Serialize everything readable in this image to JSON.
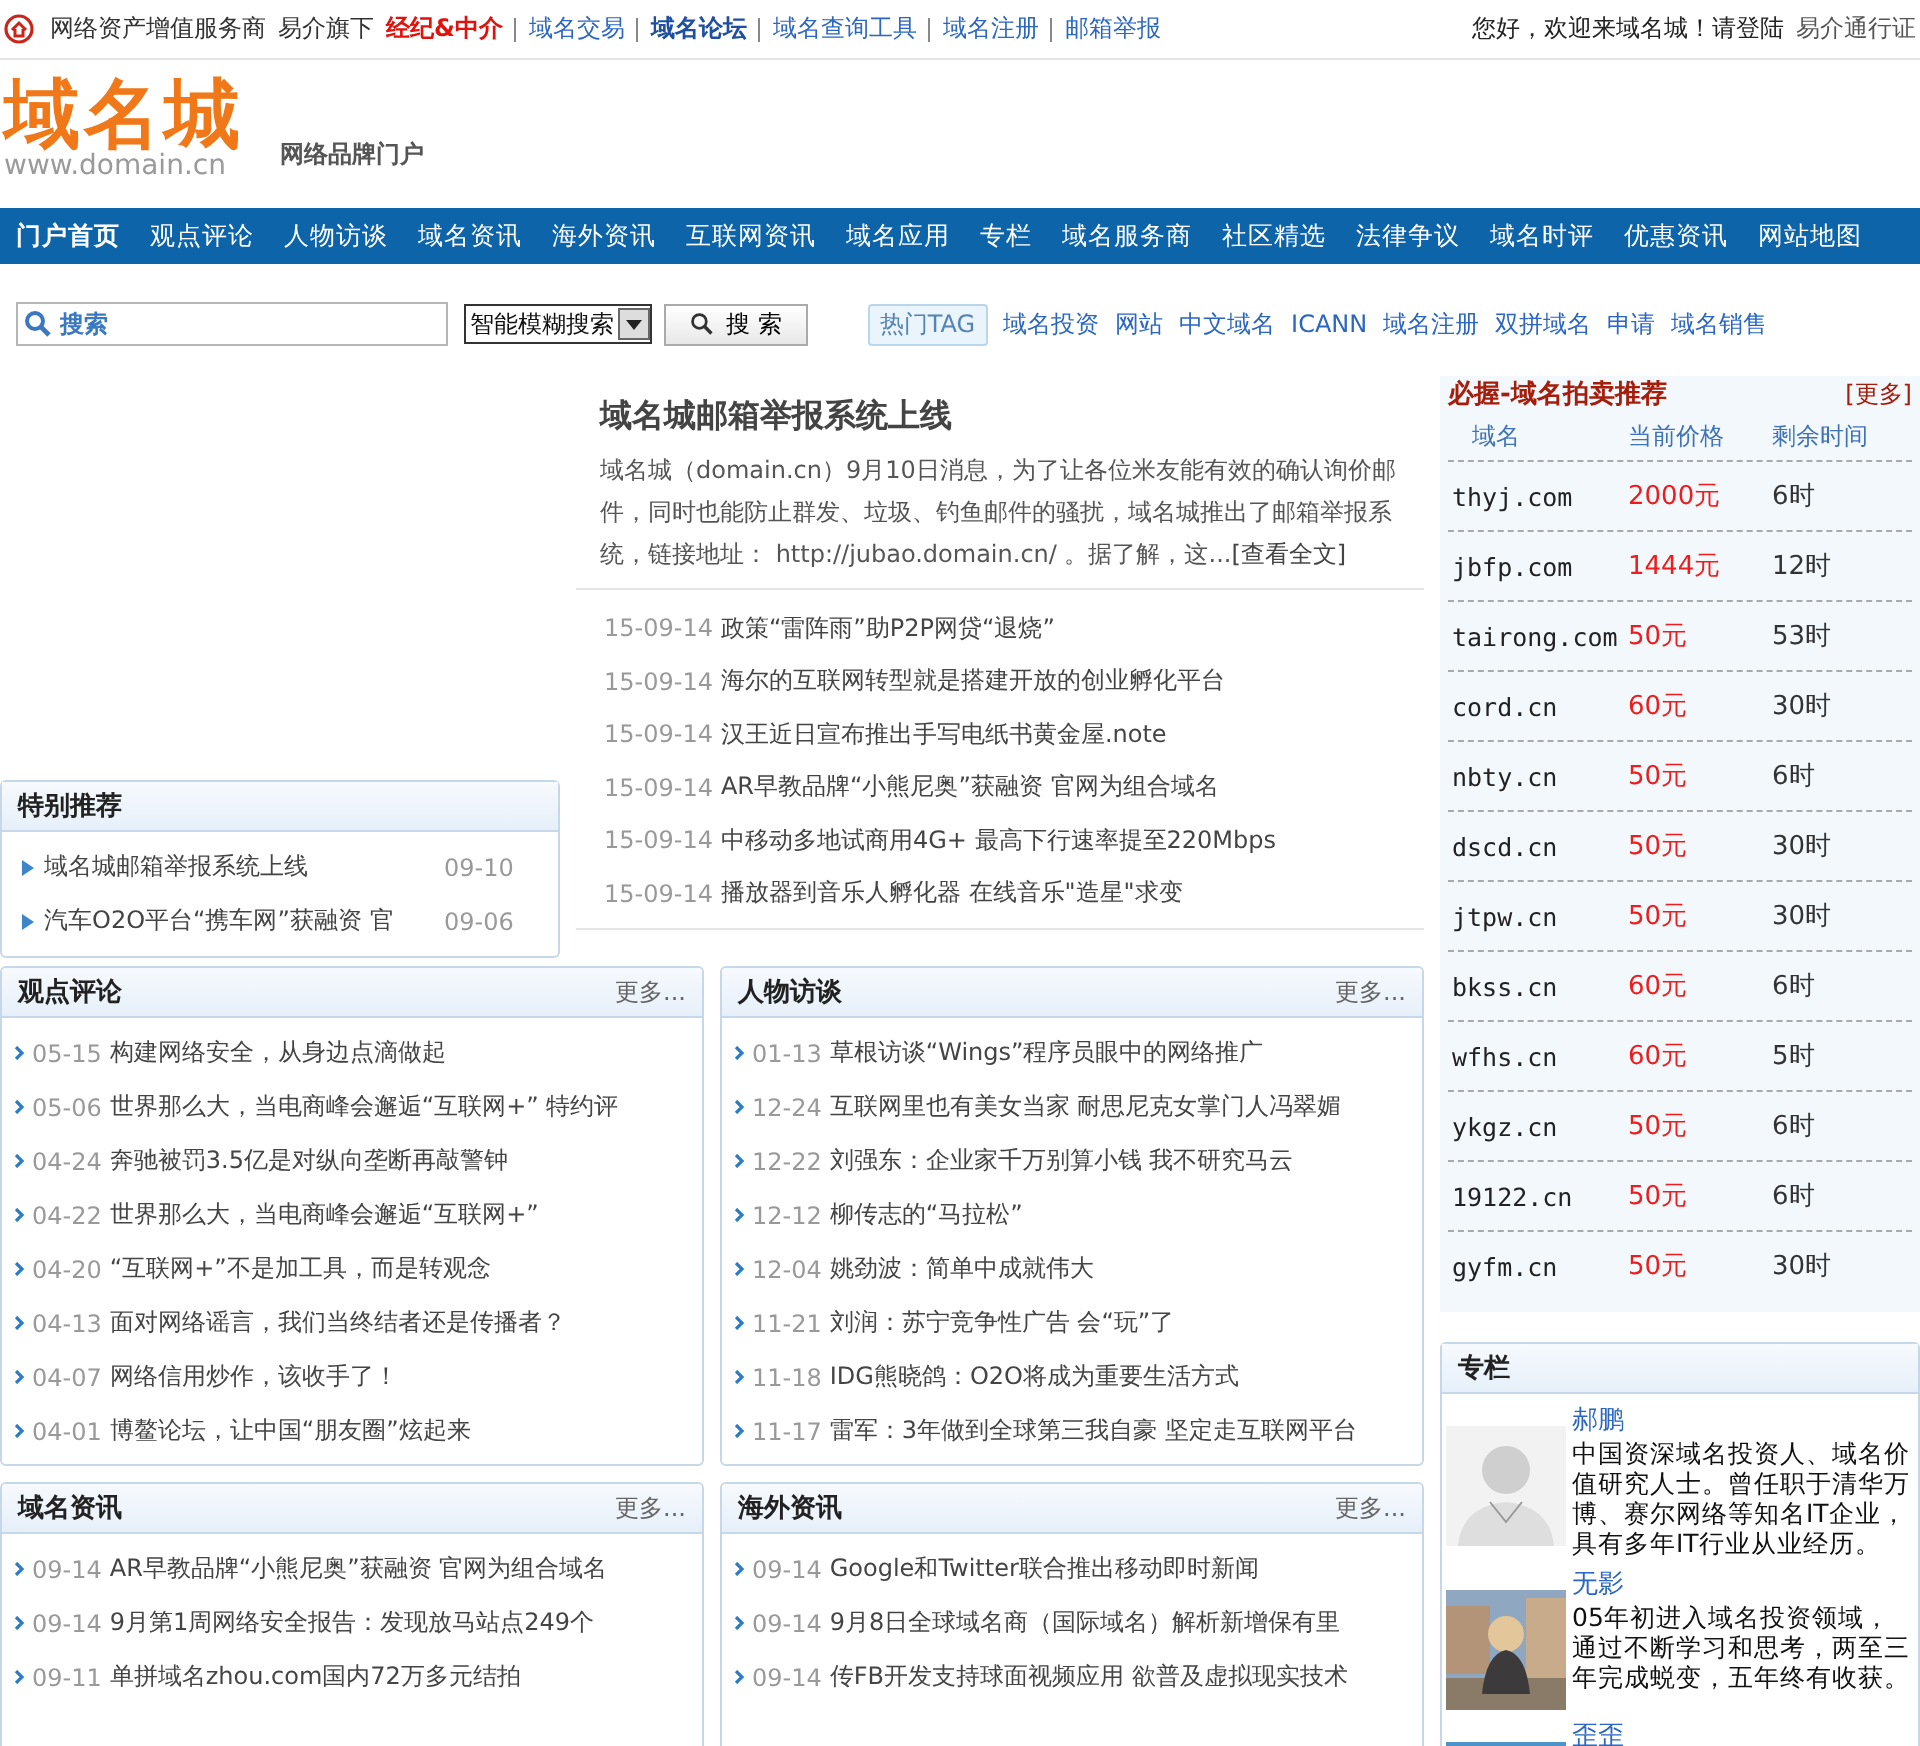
{
  "top_bar": {
    "left": [
      {
        "text": "网络资产增值服务商",
        "kind": "plain"
      },
      {
        "text": "易介旗下",
        "kind": "plain"
      },
      {
        "text": "经纪&中介",
        "kind": "hot"
      },
      {
        "text": "域名交易",
        "kind": "link"
      },
      {
        "text": "域名论坛",
        "kind": "strong"
      },
      {
        "text": "域名查询工具",
        "kind": "link"
      },
      {
        "text": "域名注册",
        "kind": "link"
      },
      {
        "text": "邮箱举报",
        "kind": "link"
      }
    ],
    "greeting": "您好，欢迎来域名城！请登陆",
    "passport": "易介通行证"
  },
  "header": {
    "logo": "域名城",
    "logo_url": "www.domain.cn",
    "tagline": "网络品牌门户"
  },
  "nav": [
    {
      "label": "门户首页",
      "selected": true
    },
    {
      "label": "观点评论",
      "selected": false
    },
    {
      "label": "人物访谈",
      "selected": false
    },
    {
      "label": "域名资讯",
      "selected": false
    },
    {
      "label": "海外资讯",
      "selected": false
    },
    {
      "label": "互联网资讯",
      "selected": false
    },
    {
      "label": "域名应用",
      "selected": false
    },
    {
      "label": "专栏",
      "selected": false
    },
    {
      "label": "域名服务商",
      "selected": false
    },
    {
      "label": "社区精选",
      "selected": false
    },
    {
      "label": "法律争议",
      "selected": false
    },
    {
      "label": "域名时评",
      "selected": false
    },
    {
      "label": "优惠资讯",
      "selected": false
    },
    {
      "label": "网站地图",
      "selected": false
    }
  ],
  "search": {
    "placeholder": "搜索",
    "mode": "智能模糊搜索",
    "button": "搜 索",
    "tag_label": "热门TAG",
    "tags": [
      "域名投资",
      "网站",
      "中文域名",
      "ICANN",
      "域名注册",
      "双拼域名",
      "申请",
      "域名销售"
    ]
  },
  "special": {
    "title": "特别推荐",
    "items": [
      {
        "title": "域名城邮箱举报系统上线",
        "date": "09-10"
      },
      {
        "title": "汽车O2O平台“携车网”获融资 官",
        "date": "09-06"
      }
    ]
  },
  "headline": {
    "title": "域名城邮箱举报系统上线",
    "summary": "域名城（domain.cn）9月10日消息，为了让各位米友能有效的确认询价邮件，同时也能防止群发、垃圾、钓鱼邮件的骚扰，域名城推出了邮箱举报系统，链接地址： http://jubao.domain.cn/ 。据了解，这...",
    "read_more": "[查看全文]"
  },
  "latest": [
    {
      "date": "15-09-14",
      "title": "政策“雷阵雨”助P2P网贷“退烧”"
    },
    {
      "date": "15-09-14",
      "title": "海尔的互联网转型就是搭建开放的创业孵化平台"
    },
    {
      "date": "15-09-14",
      "title": "汉王近日宣布推出手写电纸书黄金屋.note"
    },
    {
      "date": "15-09-14",
      "title": "AR早教品牌“小熊尼奥”获融资 官网为组合域名"
    },
    {
      "date": "15-09-14",
      "title": "中移动多地试商用4G+ 最高下行速率提至220Mbps"
    },
    {
      "date": "15-09-14",
      "title": "播放器到音乐人孵化器 在线音乐\"造星\"求变"
    }
  ],
  "sections": [
    {
      "title": "观点评论",
      "more": "更多...",
      "items": [
        {
          "date": "05-15",
          "title": "构建网络安全，从身边点滴做起"
        },
        {
          "date": "05-06",
          "title": "世界那么大，当电商峰会邂逅“互联网+” 特约评"
        },
        {
          "date": "04-24",
          "title": "奔驰被罚3.5亿是对纵向垄断再敲警钟"
        },
        {
          "date": "04-22",
          "title": "世界那么大，当电商峰会邂逅“互联网+”"
        },
        {
          "date": "04-20",
          "title": "“互联网+”不是加工具，而是转观念"
        },
        {
          "date": "04-13",
          "title": "面对网络谣言，我们当终结者还是传播者？"
        },
        {
          "date": "04-07",
          "title": "网络信用炒作，该收手了！"
        },
        {
          "date": "04-01",
          "title": "博鳌论坛，让中国“朋友圈”炫起来"
        }
      ]
    },
    {
      "title": "人物访谈",
      "more": "更多...",
      "items": [
        {
          "date": "01-13",
          "title": "草根访谈“Wings”程序员眼中的网络推广"
        },
        {
          "date": "12-24",
          "title": "互联网里也有美女当家 耐思尼克女掌门人冯翠媚"
        },
        {
          "date": "12-22",
          "title": "刘强东：企业家千万别算小钱 我不研究马云"
        },
        {
          "date": "12-12",
          "title": "柳传志的“马拉松”"
        },
        {
          "date": "12-04",
          "title": "姚劲波：简单中成就伟大"
        },
        {
          "date": "11-21",
          "title": "刘润：苏宁竞争性广告 会“玩”了"
        },
        {
          "date": "11-18",
          "title": "IDG熊晓鸽：O2O将成为重要生活方式"
        },
        {
          "date": "11-17",
          "title": "雷军：3年做到全球第三我自豪 坚定走互联网平台"
        }
      ]
    },
    {
      "title": "域名资讯",
      "more": "更多...",
      "items": [
        {
          "date": "09-14",
          "title": "AR早教品牌“小熊尼奥”获融资 官网为组合域名"
        },
        {
          "date": "09-14",
          "title": "9月第1周网络安全报告：发现放马站点249个"
        },
        {
          "date": "09-11",
          "title": "单拼域名zhou.com国内72万多元结拍"
        }
      ]
    },
    {
      "title": "海外资讯",
      "more": "更多...",
      "items": [
        {
          "date": "09-14",
          "title": "Google和Twitter联合推出移动即时新闻"
        },
        {
          "date": "09-14",
          "title": "9月8日全球域名商（国际域名）解析新增保有里"
        },
        {
          "date": "09-14",
          "title": "传FB开发支持球面视频应用 欲普及虚拟现实技术"
        }
      ]
    }
  ],
  "auction": {
    "title": "必握-域名拍卖推荐",
    "more": "[更多]",
    "columns": [
      "域名",
      "当前价格",
      "剩余时间"
    ],
    "rows": [
      {
        "domain": "thyj.com",
        "price": "2000元",
        "time": "6时"
      },
      {
        "domain": "jbfp.com",
        "price": "1444元",
        "time": "12时"
      },
      {
        "domain": "tairong.com",
        "price": "50元",
        "time": "53时"
      },
      {
        "domain": "cord.cn",
        "price": "60元",
        "time": "30时"
      },
      {
        "domain": "nbty.cn",
        "price": "50元",
        "time": "6时"
      },
      {
        "domain": "dscd.cn",
        "price": "50元",
        "time": "30时"
      },
      {
        "domain": "jtpw.cn",
        "price": "50元",
        "time": "30时"
      },
      {
        "domain": "bkss.cn",
        "price": "60元",
        "time": "6时"
      },
      {
        "domain": "wfhs.cn",
        "price": "60元",
        "time": "5时"
      },
      {
        "domain": "ykgz.cn",
        "price": "50元",
        "time": "6时"
      },
      {
        "domain": "19122.cn",
        "price": "50元",
        "time": "6时"
      },
      {
        "domain": "gyfm.cn",
        "price": "50元",
        "time": "30时"
      }
    ]
  },
  "columnists": {
    "title": "专栏",
    "people": [
      {
        "name": "郝鹏",
        "bio": "中国资深域名投资人、域名价值研究人士。曾任职于清华万博、赛尔网络等知名IT企业，具有多年IT行业从业经历。"
      },
      {
        "name": "无影",
        "bio": "05年初进入域名投资领域，通过不断学习和思考，两至三年完成蜕变，五年终有收获。"
      },
      {
        "name": "歪歪"
      }
    ]
  }
}
